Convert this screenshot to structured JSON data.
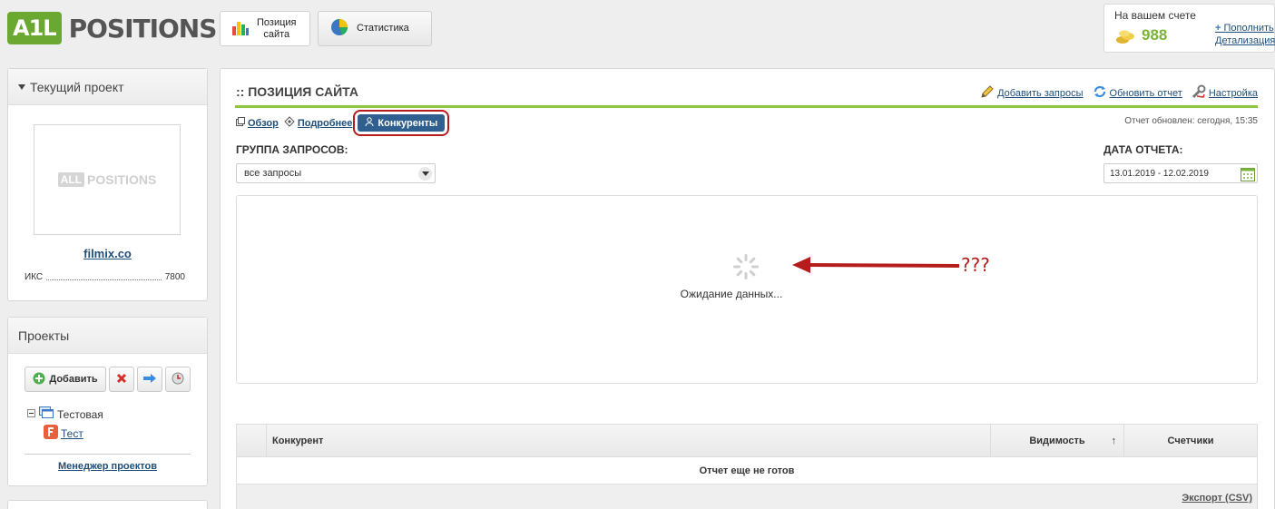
{
  "header": {
    "logo_mark": "A1L",
    "logo_text": "POSITIONS",
    "tabs": [
      {
        "label_line1": "Позиция",
        "label_line2": "сайта"
      },
      {
        "label": "Статистика"
      }
    ]
  },
  "account": {
    "title": "На вашем счете",
    "balance": "988",
    "topup": "Пополнить",
    "details": "Детализация"
  },
  "current_project": {
    "title": "Текущий проект",
    "thumb_mark": "ALL",
    "thumb_text": "POSITIONS",
    "site": "filmix.co",
    "iks_label": "ИКС",
    "iks_value": "7800"
  },
  "projects": {
    "title": "Проекты",
    "add_label": "Добавить",
    "tree": {
      "group": "Тестовая",
      "item": "Тест"
    },
    "manager": "Менеджер проектов"
  },
  "main": {
    "title": ":: ПОЗИЦИЯ САЙТА",
    "actions": [
      "Добавить запросы",
      "Обновить отчет",
      "Настройка"
    ],
    "subtabs": [
      "Обзор",
      "Подробнее",
      "Конкуренты"
    ],
    "updated": "Отчет обновлен: сегодня, 15:35",
    "group_label": "ГРУППА ЗАПРОСОВ:",
    "group_value": "все запросы",
    "date_label": "ДАТА ОТЧЕТА:",
    "date_value": "13.01.2019 - 12.02.2019",
    "wait_text": "Ожидание данных...",
    "annotation": "???",
    "table": {
      "headers": [
        "Конкурент",
        "Видимость",
        "Счетчики"
      ],
      "sort_arrow": "↑",
      "empty": "Отчет еще не готов",
      "export": "Экспорт (CSV)"
    }
  },
  "colors": {
    "accent_green": "#8dc63f",
    "tab_blue": "#2f5f8e",
    "annotation_red": "#b51c1c"
  }
}
